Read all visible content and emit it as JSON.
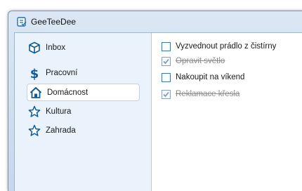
{
  "window": {
    "title": "GeeTeeDee"
  },
  "sidebar": {
    "items": [
      {
        "label": "Inbox",
        "icon": "cube-icon",
        "selected": false
      },
      {
        "label": "Pracovní",
        "icon": "dollar-icon",
        "selected": false
      },
      {
        "label": "Domácnost",
        "icon": "home-icon",
        "selected": true
      },
      {
        "label": "Kultura",
        "icon": "star-icon",
        "selected": false
      },
      {
        "label": "Zahrada",
        "icon": "star-icon",
        "selected": false
      }
    ]
  },
  "tasks": [
    {
      "label": "Vyzvednout prádlo z čistírny",
      "done": false
    },
    {
      "label": "Opravit světlo",
      "done": true
    },
    {
      "label": "Nakoupit na víkend",
      "done": false
    },
    {
      "label": "Reklamace křesla",
      "done": true
    }
  ],
  "colors": {
    "accent": "#1c6fb5",
    "sidebar_bg": "#eaf2fb",
    "done_text": "#8a8a8a"
  }
}
